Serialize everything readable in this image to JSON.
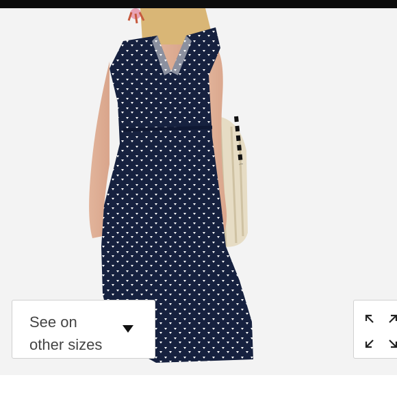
{
  "size_selector": {
    "label": "See on\nother sizes",
    "icon": "caret-down-icon"
  },
  "expand_control": {
    "icon": "expand-arrows-icon"
  },
  "photo": {
    "dress_color": "#16213f",
    "dot_color": "#ffffff",
    "background_color": "#f3f3f3"
  }
}
